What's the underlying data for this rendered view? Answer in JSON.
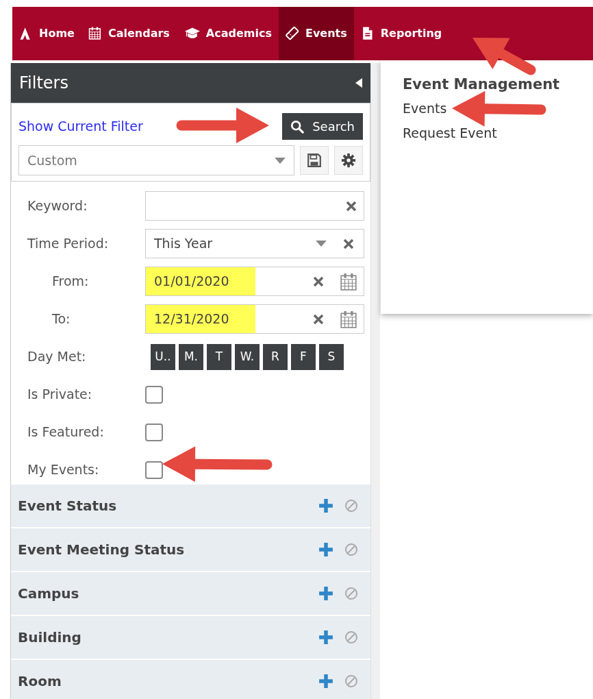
{
  "nav": {
    "items": [
      {
        "label": "Home",
        "kind": "logo",
        "selected": false
      },
      {
        "label": "Calendars",
        "kind": "calendar",
        "selected": false
      },
      {
        "label": "Academics",
        "kind": "cap",
        "selected": false
      },
      {
        "label": "Events",
        "kind": "ticket",
        "selected": true
      },
      {
        "label": "Reporting",
        "kind": "document",
        "selected": false
      }
    ]
  },
  "menu": {
    "heading": "Event Management",
    "items": [
      {
        "label": "Events"
      },
      {
        "label": "Request Event"
      }
    ]
  },
  "filters": {
    "title": "Filters",
    "show_filter_link": "Show Current Filter",
    "search_button": "Search",
    "preset": {
      "value": "Custom"
    },
    "fields": [
      {
        "kind": "text",
        "label": "Keyword:"
      },
      {
        "kind": "select",
        "label": "Time Period:",
        "value": "This Year"
      },
      {
        "kind": "date",
        "label": "From:",
        "value": "01/01/2020",
        "highlighted": true
      },
      {
        "kind": "date",
        "label": "To:",
        "value": "12/31/2020",
        "highlighted": true
      },
      {
        "kind": "days",
        "label": "Day Met:",
        "days": [
          {
            "label": "U..",
            "selected": true
          },
          {
            "label": "M.",
            "selected": true
          },
          {
            "label": "T",
            "selected": true
          },
          {
            "label": "W.",
            "selected": true
          },
          {
            "label": "R",
            "selected": true
          },
          {
            "label": "F",
            "selected": true
          },
          {
            "label": "S",
            "selected": true
          }
        ]
      },
      {
        "kind": "checkbox",
        "label": "Is Private:",
        "checked": false
      },
      {
        "kind": "checkbox",
        "label": "Is Featured:",
        "checked": false
      },
      {
        "kind": "checkbox",
        "label": "My Events:",
        "checked": false
      }
    ],
    "sections": [
      {
        "label": "Event Status"
      },
      {
        "label": "Event Meeting Status"
      },
      {
        "label": "Campus"
      },
      {
        "label": "Building"
      },
      {
        "label": "Room"
      }
    ]
  }
}
